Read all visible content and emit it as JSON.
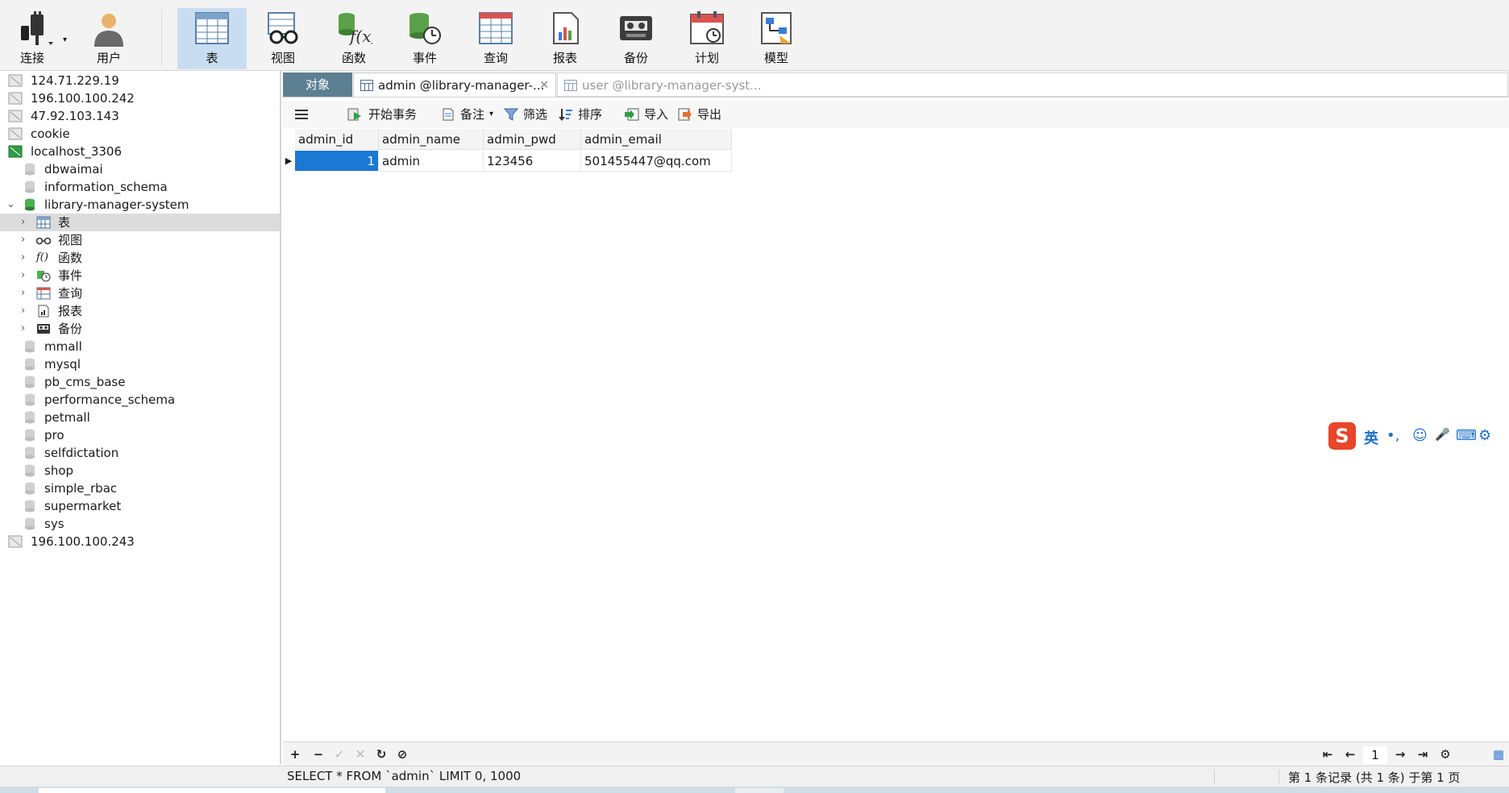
{
  "colors": {
    "accent": "#1b78d3",
    "tab_objects_bg": "#5d7f92",
    "toolbar_active": "#c9ddf2",
    "ime_brand": "#e8452a"
  },
  "toolbar": {
    "connect": "连接",
    "user": "用户",
    "table": "表",
    "view": "视图",
    "function": "函数",
    "event": "事件",
    "query": "查询",
    "report": "报表",
    "backup": "备份",
    "schedule": "计划",
    "model": "模型"
  },
  "tree": {
    "servers_top": [
      "124.71.229.19",
      "196.100.100.242",
      "47.92.103.143",
      "cookie"
    ],
    "localhost": "localhost_3306",
    "db_before": [
      "dbwaimai",
      "information_schema"
    ],
    "active_db": "library-manager-system",
    "active_db_children": [
      "表",
      "视图",
      "函数",
      "事件",
      "查询",
      "报表",
      "备份"
    ],
    "db_after": [
      "mmall",
      "mysql",
      "pb_cms_base",
      "performance_schema",
      "petmall",
      "pro",
      "selfdictation",
      "shop",
      "simple_rbac",
      "supermarket",
      "sys"
    ],
    "server_bottom": "196.100.100.243"
  },
  "tabs": {
    "objects": "对象",
    "admin": "admin @library-manager-...",
    "user": "user @library-manager-syst..."
  },
  "data_toolbar": {
    "begin_transaction": "开始事务",
    "memo": "备注",
    "filter": "筛选",
    "sort": "排序",
    "import": "导入",
    "export": "导出"
  },
  "grid": {
    "columns": [
      "admin_id",
      "admin_name",
      "admin_pwd",
      "admin_email"
    ],
    "rows": [
      [
        "1",
        "admin",
        "123456",
        "501455447@qq.com"
      ]
    ]
  },
  "pager": {
    "page": "1"
  },
  "status": {
    "sql": "SELECT * FROM `admin` LIMIT 0, 1000",
    "records": "第 1 条记录 (共 1 条) 于第 1 页"
  },
  "ime": {
    "logo": "S",
    "lang": "英",
    "punct": "•,",
    "emoji": "☺",
    "voice": "🎤",
    "keyboard": "⌨",
    "more": "⚙"
  }
}
